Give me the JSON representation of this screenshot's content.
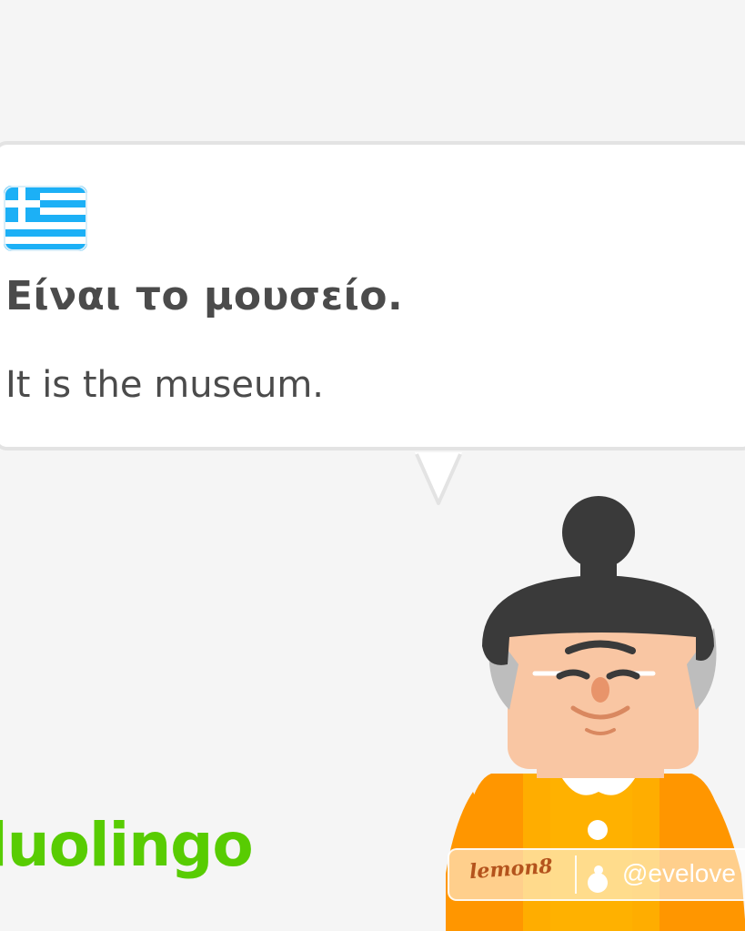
{
  "prompt": {
    "language_flag": "greek-flag-icon",
    "phrase": "Είναι το μουσείο.",
    "translation": "It is the museum."
  },
  "brand": {
    "logo_text": "luolingo"
  },
  "watermark": {
    "app_name": "lemon8",
    "username": "@evelove"
  },
  "colors": {
    "brand_green": "#58cc02",
    "text_dark": "#4b4b4b",
    "flag_blue": "#1cb0f6",
    "shirt_orange": "#ff9600"
  }
}
